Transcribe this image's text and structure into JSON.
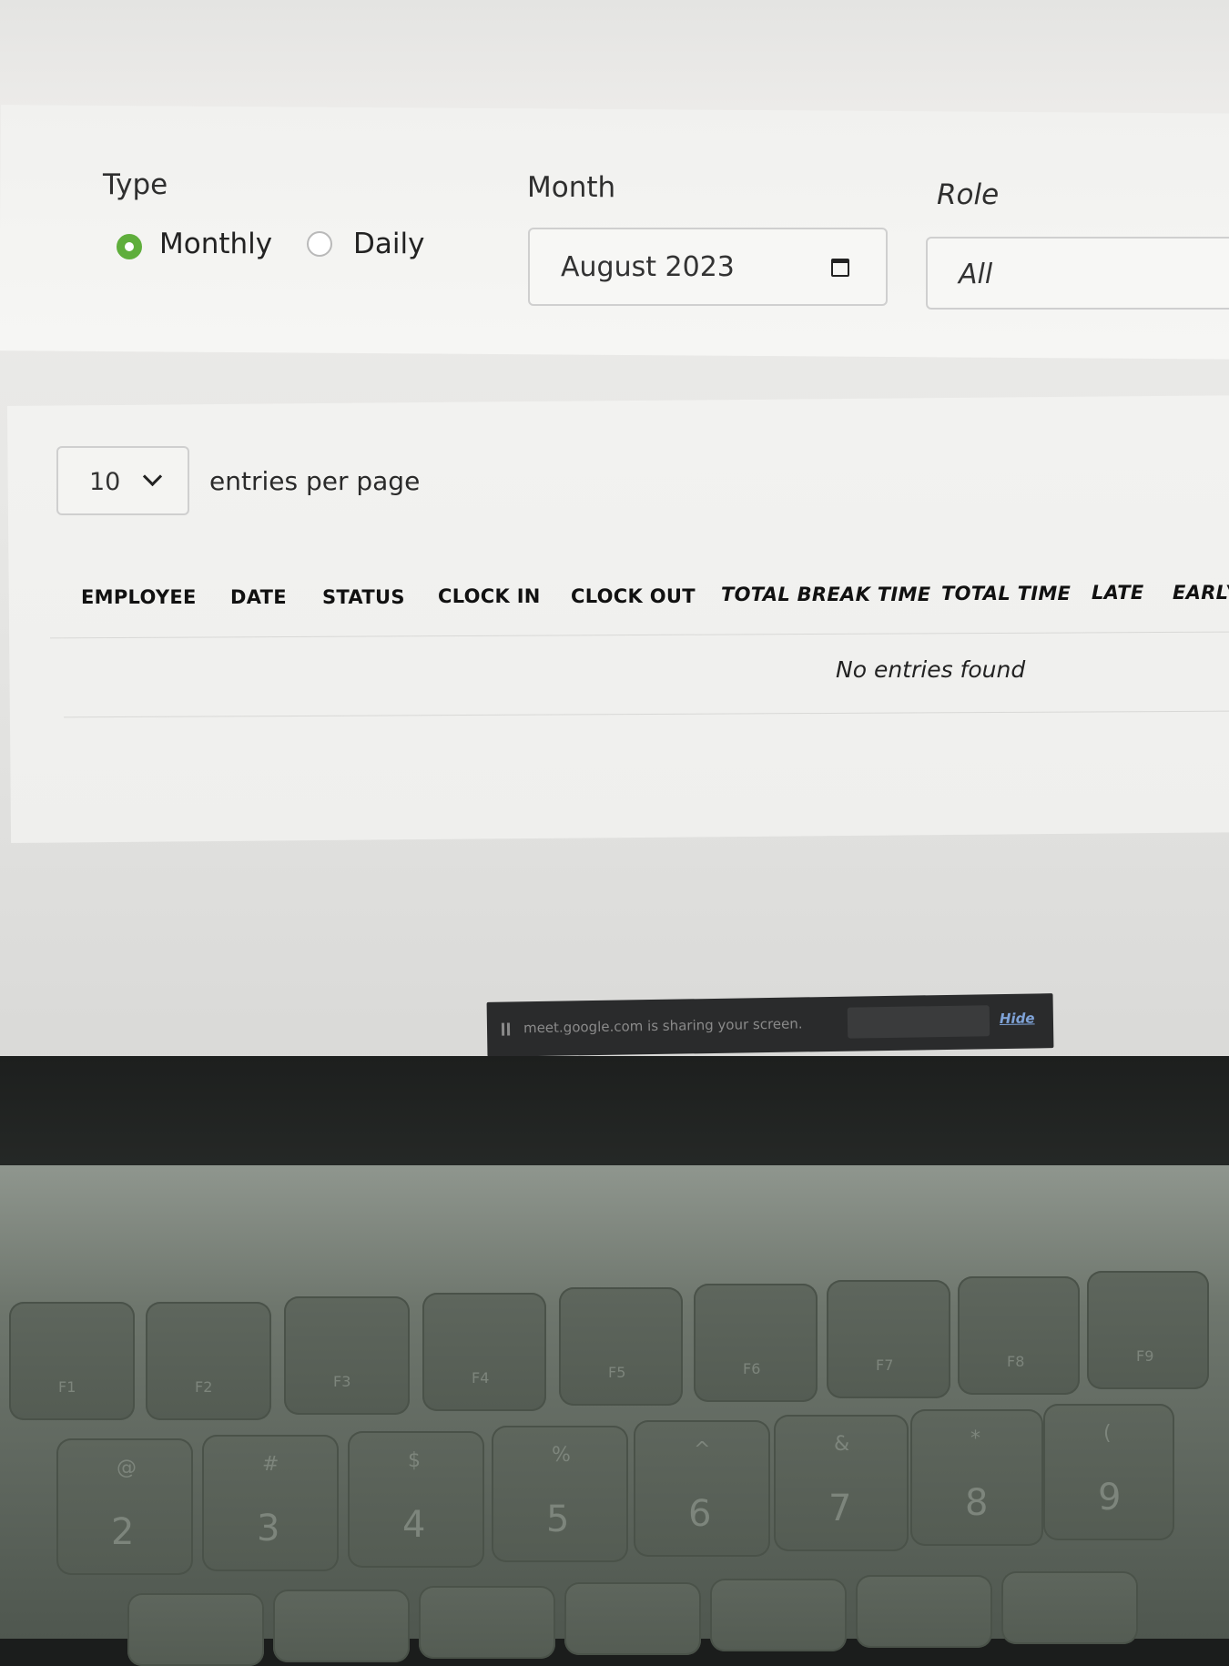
{
  "filters": {
    "type_label": "Type",
    "type_options": [
      "Monthly",
      "Daily"
    ],
    "type_selected": "Monthly",
    "month_label": "Month",
    "month_value": "August 2023",
    "role_label": "Role",
    "role_value": "All"
  },
  "entries": {
    "per_page_value": "10",
    "per_page_label": "entries per page"
  },
  "table": {
    "columns": [
      "EMPLOYEE",
      "DATE",
      "STATUS",
      "CLOCK IN",
      "CLOCK OUT",
      "TOTAL BREAK TIME",
      "TOTAL TIME",
      "LATE",
      "EARLY"
    ],
    "empty_message": "No entries found"
  },
  "screen_share": {
    "message": "meet.google.com is sharing your screen.",
    "hide_label": "Hide"
  },
  "keyboard": {
    "function_keys": [
      "F1",
      "F2",
      "F3",
      "F4",
      "F5",
      "F6",
      "F7",
      "F8",
      "F9"
    ],
    "number_keys": [
      {
        "symbol": "@",
        "digit": "2"
      },
      {
        "symbol": "#",
        "digit": "3"
      },
      {
        "symbol": "$",
        "digit": "4"
      },
      {
        "symbol": "%",
        "digit": "5"
      },
      {
        "symbol": "^",
        "digit": "6"
      },
      {
        "symbol": "&",
        "digit": "7"
      },
      {
        "symbol": "*",
        "digit": "8"
      },
      {
        "symbol": "(",
        "digit": "9"
      }
    ]
  },
  "colors": {
    "accent": "#5fae3c",
    "screen_bg": "#ecebe9"
  }
}
